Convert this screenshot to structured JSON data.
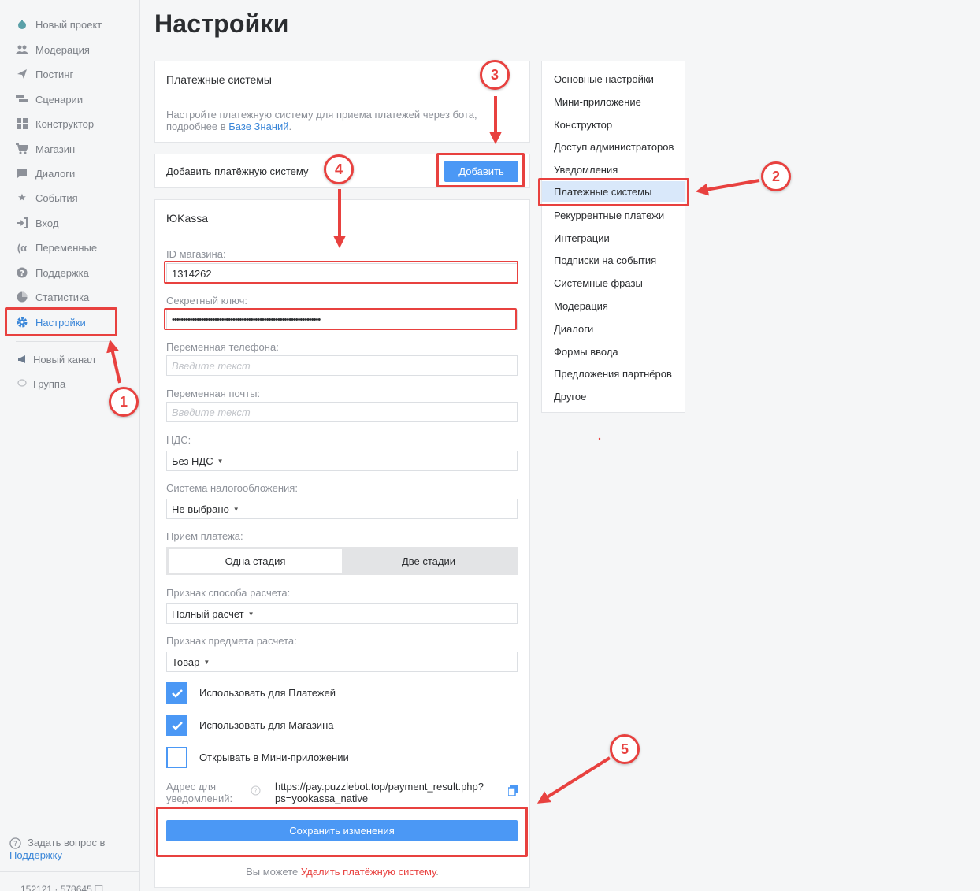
{
  "sidebar": {
    "items": [
      {
        "label": "Новый проект",
        "icon": "bot-icon"
      },
      {
        "label": "Модерация",
        "icon": "users-icon"
      },
      {
        "label": "Постинг",
        "icon": "send-icon"
      },
      {
        "label": "Сценарии",
        "icon": "scenario-icon"
      },
      {
        "label": "Конструктор",
        "icon": "grid-icon"
      },
      {
        "label": "Магазин",
        "icon": "cart-icon"
      },
      {
        "label": "Диалоги",
        "icon": "chat-icon"
      },
      {
        "label": "События",
        "icon": "star-icon"
      },
      {
        "label": "Вход",
        "icon": "login-icon"
      },
      {
        "label": "Переменные",
        "icon": "variable-icon"
      },
      {
        "label": "Поддержка",
        "icon": "question-icon"
      },
      {
        "label": "Статистика",
        "icon": "pie-chart-icon"
      },
      {
        "label": "Настройки",
        "icon": "gear-icon"
      }
    ],
    "channels": [
      {
        "label": "Новый канал",
        "icon": "megaphone-icon"
      },
      {
        "label": "Группа",
        "icon": "chat-bubble-icon"
      }
    ],
    "help_text": "Задать вопрос в",
    "help_link": "Поддержку",
    "ids": "152121 · 578645"
  },
  "page": {
    "title": "Настройки"
  },
  "payment_card": {
    "title": "Платежные системы",
    "desc": "Настройте платежную систему для приема платежей через бота, подробнее в",
    "desc_link": "Базе Знаний",
    "desc_end": "."
  },
  "add_card": {
    "label": "Добавить платёжную систему",
    "button": "Добавить"
  },
  "yookassa": {
    "title": "ЮKassa",
    "shop_id_label": "ID магазина:",
    "shop_id_value": "1314262",
    "secret_label": "Секретный ключ:",
    "secret_value": "••••••••••••••••••••••••••••••••••••••••••••••••••••••••••••••••••",
    "phone_label": "Переменная телефона:",
    "email_label": "Переменная почты:",
    "placeholder": "Введите текст",
    "vat_label": "НДС:",
    "vat_value": "Без НДС",
    "tax_label": "Система налогообложения:",
    "tax_value": "Не выбрано",
    "accept_label": "Прием платежа:",
    "accept_options": [
      "Одна стадия",
      "Две стадии"
    ],
    "calc_method_label": "Признак способа расчета:",
    "calc_method_value": "Полный расчет",
    "calc_subject_label": "Признак предмета расчета:",
    "calc_subject_value": "Товар",
    "checks": [
      {
        "label": "Использовать для Платежей",
        "checked": true
      },
      {
        "label": "Использовать для Магазина",
        "checked": true
      },
      {
        "label": "Открывать в Мини-приложении",
        "checked": false
      }
    ],
    "notify_label_1": "Адрес для",
    "notify_label_2": "уведомлений:",
    "notify_url_1": "https://pay.puzzlebot.top/payment_result.php?",
    "notify_url_2": "ps=yookassa_native",
    "save_button": "Сохранить изменения",
    "footer_text": "Вы можете",
    "footer_link": "Удалить платёжную систему",
    "footer_end": "."
  },
  "settings_menu": [
    "Основные настройки",
    "Мини-приложение",
    "Конструктор",
    "Доступ администраторов",
    "Уведомления",
    "Платежные системы",
    "Рекуррентные платежи",
    "Интеграции",
    "Подписки на события",
    "Системные фразы",
    "Модерация",
    "Диалоги",
    "Формы ввода",
    "Предложения партнёров",
    "Другое"
  ],
  "annotations": [
    "1",
    "2",
    "3",
    "4",
    "5"
  ],
  "colors": {
    "accent": "#4b98f5",
    "annotation": "#e8413f",
    "link": "#3a86d8"
  }
}
